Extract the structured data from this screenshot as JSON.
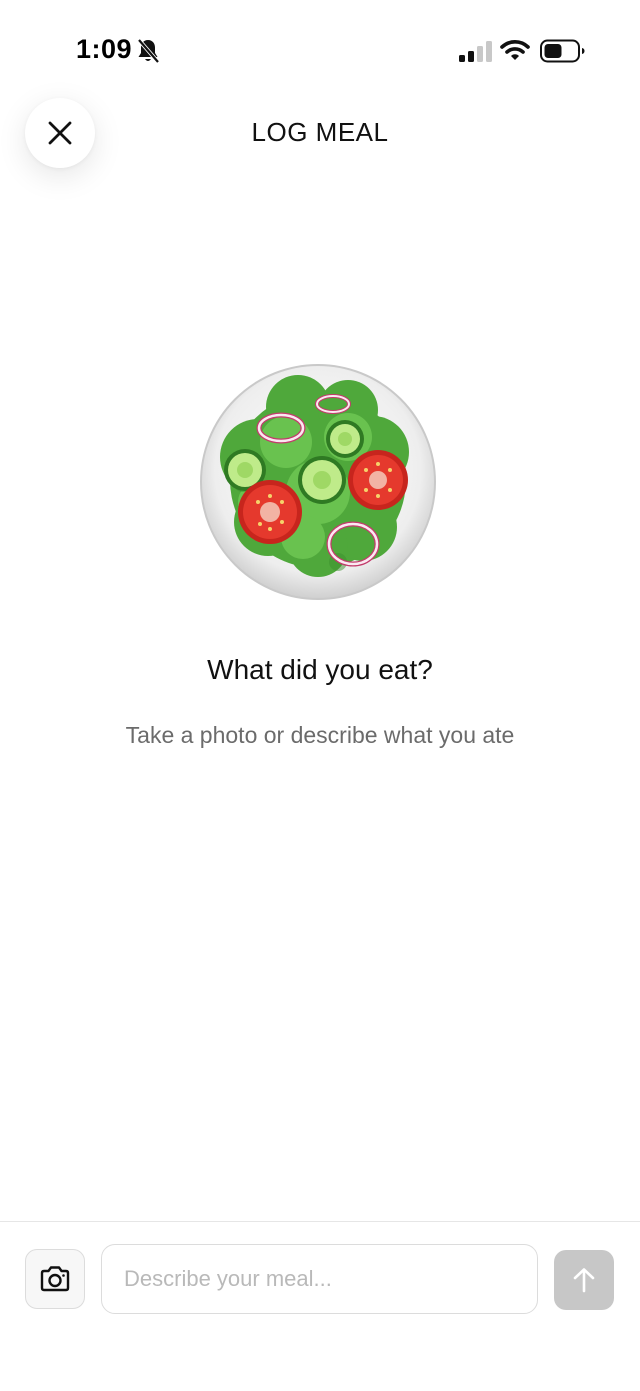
{
  "status_bar": {
    "time": "1:09",
    "icons": [
      "bell-slash-icon",
      "cellular-signal-icon",
      "wifi-icon",
      "battery-icon"
    ]
  },
  "header": {
    "title": "LOG MEAL",
    "close_icon": "close-icon"
  },
  "empty_state": {
    "illustration": "salad-bowl-icon",
    "heading": "What did you eat?",
    "subtext": "Take a photo or describe what you ate"
  },
  "composer": {
    "camera_icon": "camera-icon",
    "input_value": "",
    "input_placeholder": "Describe your meal...",
    "send_icon": "arrow-up-icon",
    "send_enabled": false
  },
  "colors": {
    "send_disabled": "#c7c7c7",
    "lettuce": "#55ad3f",
    "tomato": "#e5332a",
    "cucumber": "#8fd35e"
  }
}
